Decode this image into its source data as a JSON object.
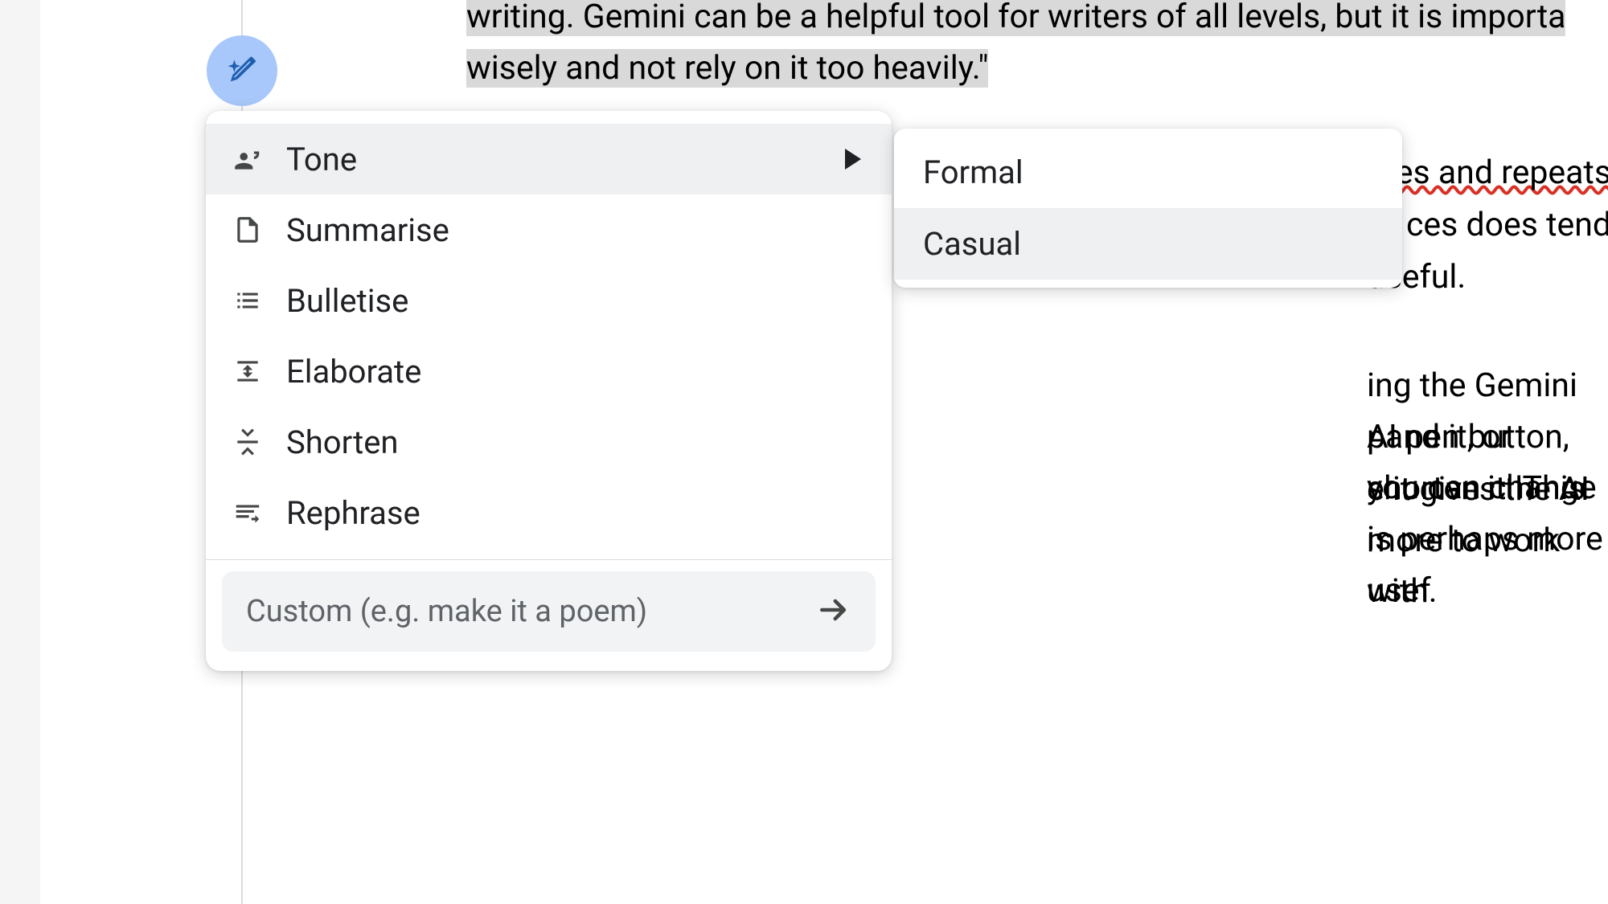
{
  "document": {
    "para1_text": "writing. Gemini can be a helpful tool for writers of all levels, but it is importa",
    "para1_text_end": "wisely and not rely on it too heavily.\"",
    "para2_frag_a": "es and repeats",
    "para2_frag_b": "ces does tend",
    "para2_frag_c": "useful.",
    "para3_frag_a": "ing the Gemini AI pen button, you can change i",
    "para3_frag_b": "pand it, or shorten it. This is perhaps more usef",
    "para3_frag_c": "e it gives the AI more to work with."
  },
  "menu": {
    "items": [
      {
        "label": "Tone"
      },
      {
        "label": "Summarise"
      },
      {
        "label": "Bulletise"
      },
      {
        "label": "Elaborate"
      },
      {
        "label": "Shorten"
      },
      {
        "label": "Rephrase"
      }
    ],
    "custom_placeholder": "Custom (e.g. make it a poem)"
  },
  "submenu": {
    "items": [
      {
        "label": "Formal"
      },
      {
        "label": "Casual"
      }
    ]
  }
}
